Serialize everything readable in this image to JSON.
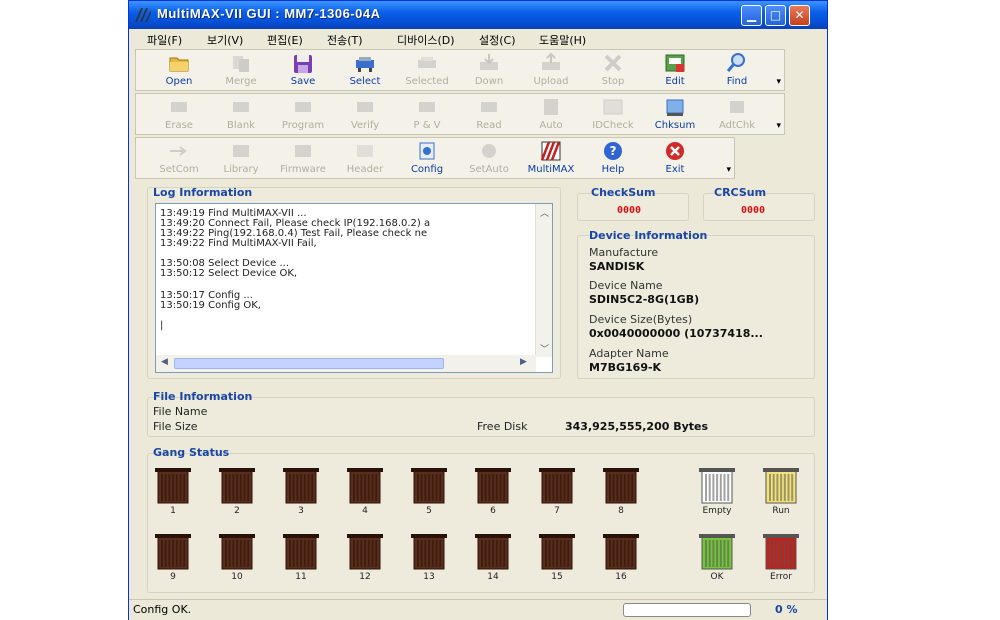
{
  "window": {
    "title": "MultiMAX-VII GUI : MM7-1306-04A"
  },
  "menu": [
    "파일(F)",
    "보기(V)",
    "편집(E)",
    "전송(T)",
    "디바이스(D)",
    "설정(C)",
    "도움말(H)"
  ],
  "toolbar1": [
    {
      "label": "Open",
      "icon": "folder-icon",
      "enabled": true
    },
    {
      "label": "Merge",
      "icon": "merge-icon",
      "enabled": false
    },
    {
      "label": "Save",
      "icon": "floppy-icon",
      "enabled": true
    },
    {
      "label": "Select",
      "icon": "select-icon",
      "enabled": true
    },
    {
      "label": "Selected",
      "icon": "selected-icon",
      "enabled": false
    },
    {
      "label": "Down",
      "icon": "download-icon",
      "enabled": false
    },
    {
      "label": "Upload",
      "icon": "upload-icon",
      "enabled": false
    },
    {
      "label": "Stop",
      "icon": "stop-icon",
      "enabled": false
    },
    {
      "label": "Edit",
      "icon": "edit-icon",
      "enabled": true
    },
    {
      "label": "Find",
      "icon": "magnifier-icon",
      "enabled": true
    }
  ],
  "toolbar2": [
    {
      "label": "Erase",
      "icon": "erase-icon",
      "enabled": false
    },
    {
      "label": "Blank",
      "icon": "blank-icon",
      "enabled": false
    },
    {
      "label": "Program",
      "icon": "program-icon",
      "enabled": false
    },
    {
      "label": "Verify",
      "icon": "verify-icon",
      "enabled": false
    },
    {
      "label": "P & V",
      "icon": "program-verify-icon",
      "enabled": false
    },
    {
      "label": "Read",
      "icon": "read-icon",
      "enabled": false
    },
    {
      "label": "Auto",
      "icon": "auto-icon",
      "enabled": false
    },
    {
      "label": "IDCheck",
      "icon": "idcheck-icon",
      "enabled": false
    },
    {
      "label": "Chksum",
      "icon": "checksum-icon",
      "enabled": true
    },
    {
      "label": "AdtChk",
      "icon": "adapter-check-icon",
      "enabled": false
    }
  ],
  "toolbar3": [
    {
      "label": "SetCom",
      "icon": "setcom-icon",
      "enabled": false
    },
    {
      "label": "Library",
      "icon": "library-icon",
      "enabled": false
    },
    {
      "label": "Firmware",
      "icon": "firmware-icon",
      "enabled": false
    },
    {
      "label": "Header",
      "icon": "header-icon",
      "enabled": false
    },
    {
      "label": "Config",
      "icon": "config-icon",
      "enabled": true
    },
    {
      "label": "SetAuto",
      "icon": "setauto-icon",
      "enabled": false
    },
    {
      "label": "MultiMAX",
      "icon": "multimax-icon",
      "enabled": true
    },
    {
      "label": "Help",
      "icon": "help-icon",
      "enabled": true
    },
    {
      "label": "Exit",
      "icon": "exit-icon",
      "enabled": true
    }
  ],
  "log": {
    "title": "Log Information",
    "lines": [
      "13:49:19 Find MultiMAX-VII ...",
      "13:49:20 Connect Fail, Please check IP(192.168.0.2) a",
      "13:49:22 Ping(192.168.0.4) Test Fail, Please check ne",
      "13:49:22 Find MultiMAX-VII Fail,",
      "",
      "13:50:08 Select Device ...",
      "13:50:12 Select Device OK,",
      "",
      "13:50:17 Config ...",
      "13:50:19 Config OK,",
      "",
      "|"
    ]
  },
  "checksum": {
    "title": "CheckSum",
    "value": "0000"
  },
  "crcsum": {
    "title": "CRCSum",
    "value": "0000"
  },
  "device": {
    "title": "Device Information",
    "manufacture_label": "Manufacture",
    "manufacture": "SANDISK",
    "name_label": "Device Name",
    "name": "SDIN5C2-8G(1GB)",
    "size_label": "Device Size(Bytes)",
    "size": "0x0040000000 (10737418...",
    "adapter_label": "Adapter Name",
    "adapter": "M7BG169-K"
  },
  "file": {
    "title": "File Information",
    "name_label": "File Name",
    "size_label": "File Size",
    "free_label": "Free Disk",
    "free_value": "343,925,555,200 Bytes"
  },
  "gang": {
    "title": "Gang Status",
    "sockets": [
      "1",
      "2",
      "3",
      "4",
      "5",
      "6",
      "7",
      "8",
      "9",
      "10",
      "11",
      "12",
      "13",
      "14",
      "15",
      "16"
    ],
    "legend": [
      {
        "label": "Empty",
        "color": "#ffffff"
      },
      {
        "label": "Run",
        "color": "#f3e27a"
      },
      {
        "label": "OK",
        "color": "#74c43c"
      },
      {
        "label": "Error",
        "color": "#c4201a"
      }
    ]
  },
  "status": {
    "text": "Config OK.",
    "percent": "0 %"
  }
}
